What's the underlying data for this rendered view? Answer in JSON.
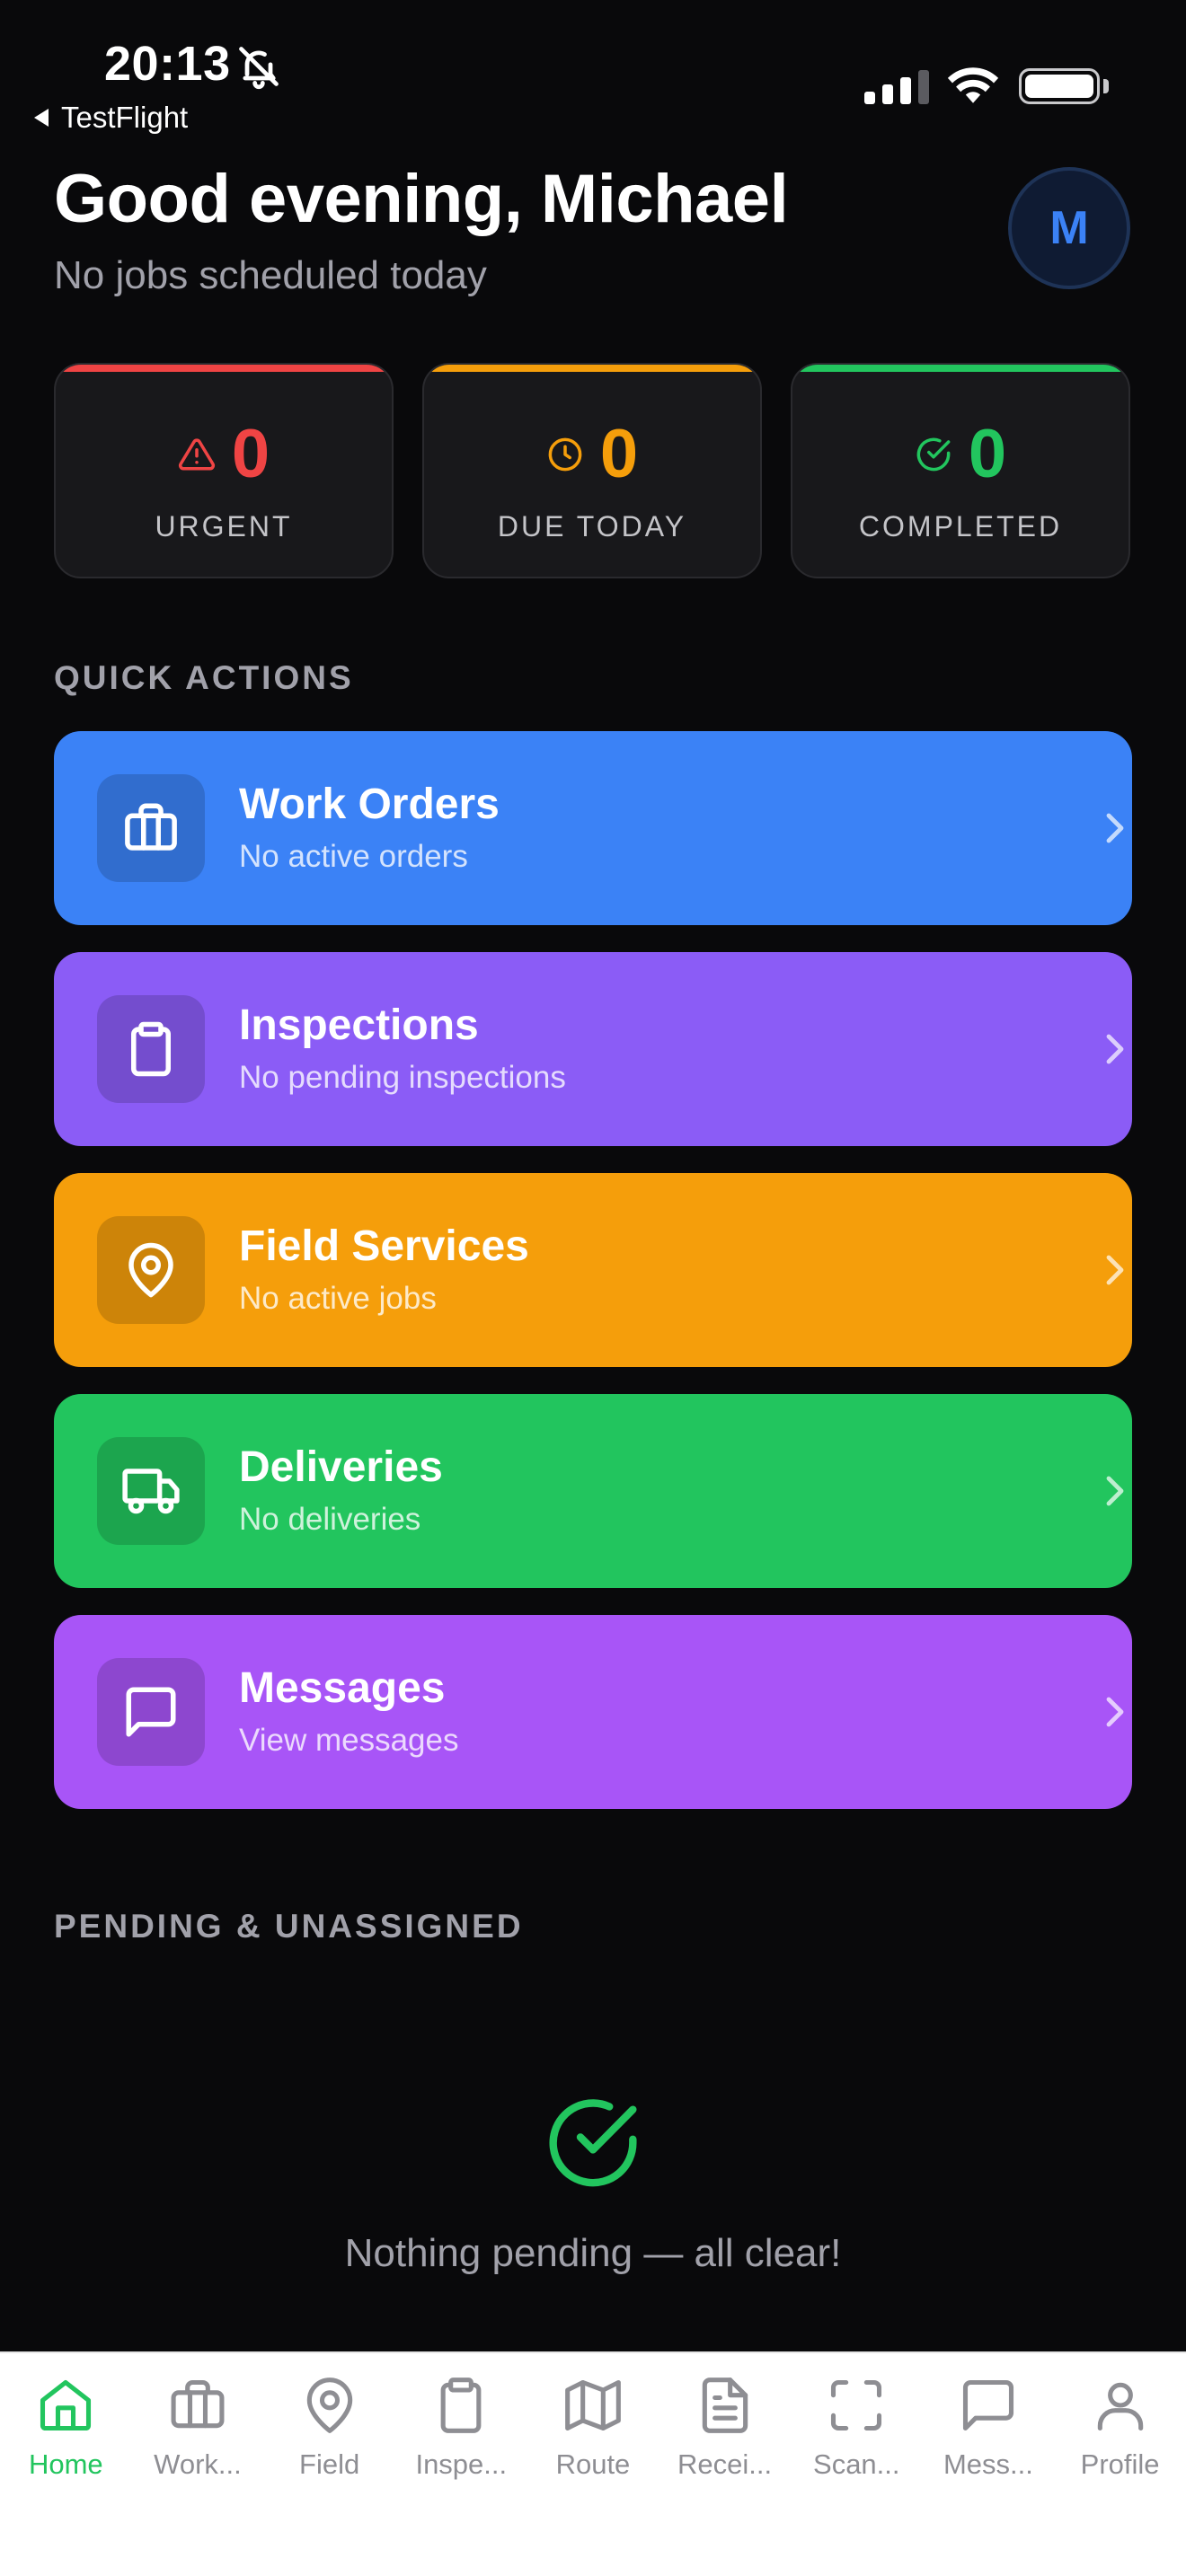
{
  "status_bar": {
    "time": "20:13",
    "back_app": "TestFlight"
  },
  "header": {
    "greeting": "Good evening, Michael",
    "subtitle": "No jobs scheduled today",
    "avatar_initial": "M"
  },
  "stats": [
    {
      "value": "0",
      "label": "URGENT",
      "color": "#ef4444",
      "icon": "alert-triangle-icon"
    },
    {
      "value": "0",
      "label": "DUE TODAY",
      "color": "#f59e0b",
      "icon": "clock-icon"
    },
    {
      "value": "0",
      "label": "COMPLETED",
      "color": "#22c55e",
      "icon": "check-circle-icon"
    }
  ],
  "sections": {
    "quick_actions": "QUICK ACTIONS",
    "pending": "PENDING & UNASSIGNED"
  },
  "actions": [
    {
      "title": "Work Orders",
      "desc": "No active orders",
      "color": "#3b82f6",
      "icon": "briefcase-icon"
    },
    {
      "title": "Inspections",
      "desc": "No pending inspections",
      "color": "#8b5cf6",
      "icon": "clipboard-icon"
    },
    {
      "title": "Field Services",
      "desc": "No active jobs",
      "color": "#f59e0b",
      "icon": "map-pin-icon"
    },
    {
      "title": "Deliveries",
      "desc": "No deliveries",
      "color": "#22c55e",
      "icon": "truck-icon"
    },
    {
      "title": "Messages",
      "desc": "View messages",
      "color": "#a855f7",
      "icon": "message-icon"
    }
  ],
  "empty_state": {
    "text": "Nothing pending — all clear!"
  },
  "tabs": [
    {
      "label": "Home",
      "icon": "home-icon",
      "active": true
    },
    {
      "label": "Work...",
      "icon": "briefcase-icon"
    },
    {
      "label": "Field",
      "icon": "map-pin-icon"
    },
    {
      "label": "Inspe...",
      "icon": "clipboard-icon"
    },
    {
      "label": "Route",
      "icon": "map-icon"
    },
    {
      "label": "Recei...",
      "icon": "document-icon"
    },
    {
      "label": "Scan...",
      "icon": "scan-icon"
    },
    {
      "label": "Mess...",
      "icon": "message-icon"
    },
    {
      "label": "Profile",
      "icon": "user-icon"
    }
  ],
  "colors": {
    "accent": "#22c55e",
    "background": "#09090b",
    "card": "#18181b"
  }
}
